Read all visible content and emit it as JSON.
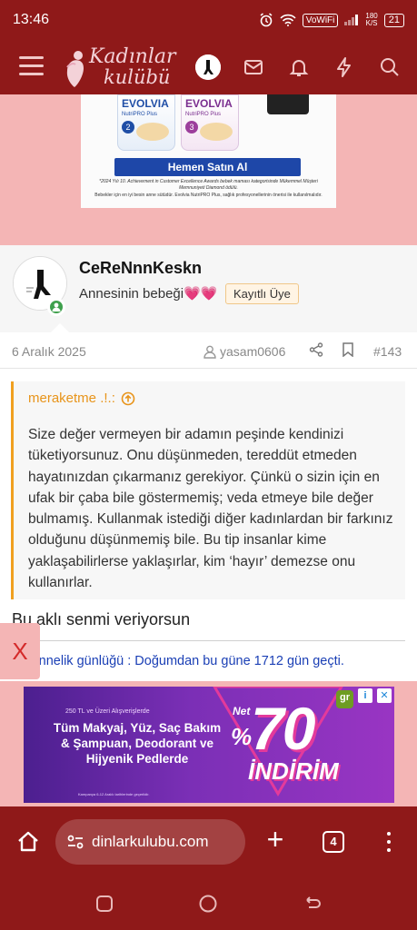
{
  "status_bar": {
    "time": "13:46",
    "vowifi": "VoWiFi",
    "net_speed_top": "180",
    "net_speed_bottom": "K/S",
    "battery": "21"
  },
  "app_bar": {
    "logo_line1": "Kadınlar",
    "logo_line2": "kulübü",
    "icons": [
      "hamburger-menu-icon",
      "user-avatar",
      "mail-icon",
      "bell-icon",
      "lightning-icon",
      "search-icon"
    ]
  },
  "ad_top": {
    "product_name": "EVOLVIA",
    "product_sub": "NutriPRO Plus",
    "button": "Hemen Satın Al",
    "fine_print": "*2024 Yılı 10. Achievement in Customer Excellence Awards bebek maması kategorisinde Mükemmel Müşteri Memnuniyeti Diamond ödülü.",
    "fine_print_2": "Bebekler için en iyi besin anne sütüdür. Evolvia NutriPRO Plus, sağlık profesyonellerinin önerisi ile kullanılmalıdır."
  },
  "post": {
    "username": "CeReNnnKeskn",
    "user_title": "Annesinin bebeği💗💗",
    "user_badge": "Kayıtlı Üye",
    "date": "6 Aralık 2025",
    "author": "yasam0606",
    "post_number": "#143",
    "quote": {
      "author": "meraketme .!.:",
      "text": "Size değer vermeyen bir adamın peşinde kendinizi tüketiyorsunuz. Onu düşünmeden, tereddüt etmeden hayatınızdan çıkarmanız gerekiyor. Çünkü o sizin için en ufak bir çaba bile göstermemiş; veda etmeye bile değer bulmamış. Kullanmak istediği diğer kadınlardan bir farkınız olduğunu düşünmemiş bile. Bu tip insanlar kime yaklaşabilirlerse yaklaşırlar, kim ‘hayır’ demezse onu kullanırlar."
    },
    "reply": "Bu aklı senmi veriyorsun",
    "signature": "Annelik günlüğü : Doğumdan bu güne 1712 gün geçti."
  },
  "close_ad": "X",
  "ad_bottom": {
    "small_text": "250 TL ve Üzeri Alışverişlerde",
    "main_text": "Tüm Makyaj, Yüz, Saç Bakım & Şampuan, Deodorant ve Hijyenik Pedlerde",
    "net": "Net",
    "percent": "%",
    "discount": "70",
    "discount_word": "İNDİRİM",
    "fine_print": "Kampanya 6-12 Aralık tarihlerinde geçerlidir.",
    "brand": "gr",
    "info": "i",
    "close": "✕"
  },
  "browser": {
    "url": "dinlarkulubu.com",
    "tab_count": "4"
  },
  "colors": {
    "header_red": "#8f1919",
    "page_pink": "#f4b5b5",
    "quote_accent": "#f0a020",
    "link_blue": "#1a3fb5",
    "online_green": "#3fa04d"
  }
}
